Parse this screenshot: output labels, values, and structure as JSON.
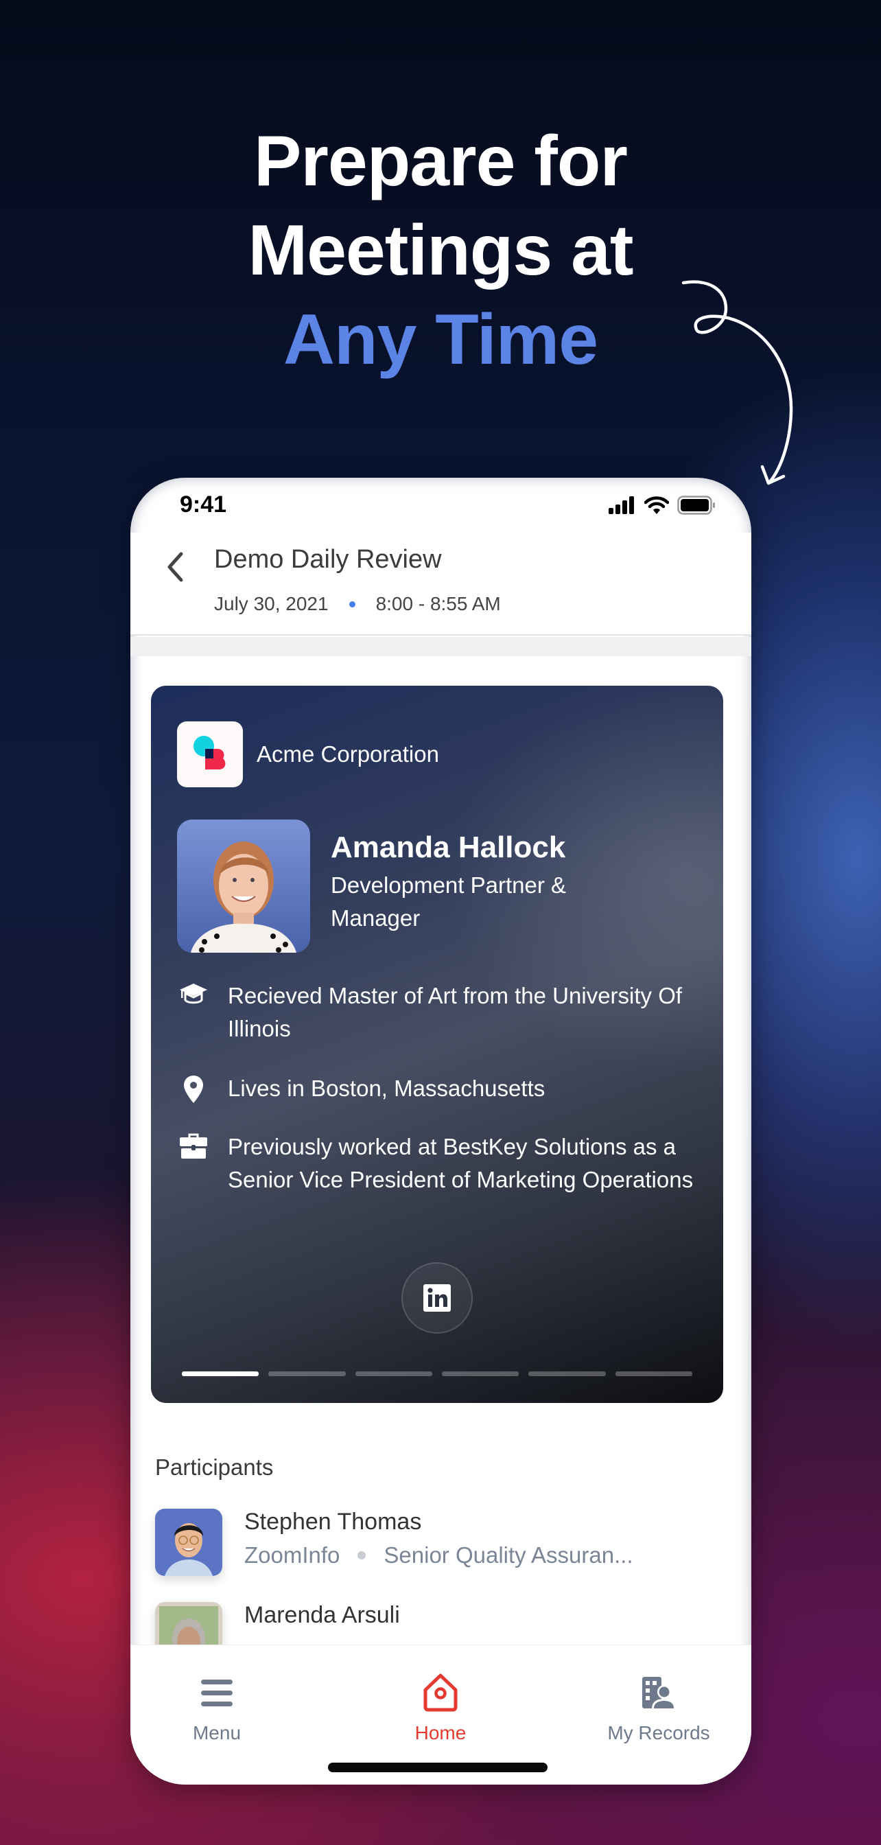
{
  "hero": {
    "line1": "Prepare for",
    "line2": "Meetings at",
    "line3_accent": "Any Time",
    "accent_color": "#5b84e6"
  },
  "status_bar": {
    "time": "9:41",
    "icons": [
      "cellular-signal-icon",
      "wifi-icon",
      "battery-icon"
    ]
  },
  "meeting": {
    "title": "Demo Daily Review",
    "date": "July 30, 2021",
    "time_range": "8:00 - 8:55 AM"
  },
  "profile_card": {
    "company": "Acme Corporation",
    "name": "Amanda Hallock",
    "title": "Development Partner & Manager",
    "facts": [
      {
        "icon": "graduation-cap-icon",
        "text": "Recieved Master of Art from the University Of Illinois"
      },
      {
        "icon": "location-pin-icon",
        "text": "Lives in Boston, Massachusetts"
      },
      {
        "icon": "briefcase-icon",
        "text": "Previously worked at BestKey Solutions as a Senior Vice President of Marketing Operations"
      }
    ],
    "social": "linkedin-icon",
    "pager": {
      "total": 6,
      "active_index": 0
    }
  },
  "participants": {
    "heading": "Participants",
    "items": [
      {
        "name": "Stephen Thomas",
        "company": "ZoomInfo",
        "role": "Senior Quality Assuran..."
      },
      {
        "name": "Marenda Arsuli",
        "company": "",
        "role": ""
      }
    ]
  },
  "tab_bar": {
    "items": [
      {
        "label": "Menu",
        "icon": "hamburger-menu-icon",
        "active": false
      },
      {
        "label": "Home",
        "icon": "home-icon",
        "active": true
      },
      {
        "label": "My Records",
        "icon": "records-icon",
        "active": false
      }
    ],
    "active_color": "#e53a2f",
    "inactive_color": "#6e7a8c"
  }
}
